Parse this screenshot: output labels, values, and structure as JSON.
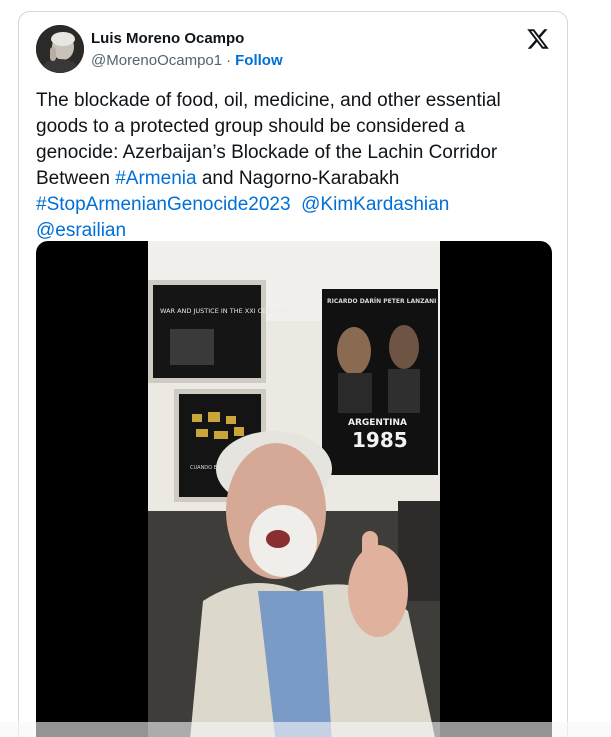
{
  "tweet": {
    "author": {
      "display_name": "Luis Moreno Ocampo",
      "handle": "@MorenoOcampo1",
      "separator": "·",
      "follow_label": "Follow"
    },
    "text": {
      "line1": "The blockade of food, oil, medicine, and other essential",
      "line2": "goods to a protected group should be considered a",
      "line3": "genocide: Azerbaijan’s Blockade of the Lachin Corridor",
      "line4_prefix": "Between ",
      "hashtag_armenia": "#Armenia",
      "line4_suffix": " and Nagorno-Karabakh",
      "hashtag_genocide": "#StopArmenianGenocide2023",
      "mention_kim": "@KimKardashian",
      "mention_esrailian": "@esrailian"
    },
    "media": {
      "poster_top_line": "RICARDO DARÍN   PETER LANZANI",
      "poster_title": "ARGENTINA",
      "poster_year": "1985",
      "frame1_title": "WAR AND JUSTICE IN THE XXI CENTURY",
      "frame2_caption": "CUANDO EL PODER PERDIÓ EL JUICIO"
    },
    "icons": {
      "brand": "x-logo-icon",
      "avatar": "avatar-photo"
    },
    "colors": {
      "link": "#006fd6",
      "text": "#0f1419",
      "secondary": "#536471",
      "border": "#cfd9de"
    }
  }
}
